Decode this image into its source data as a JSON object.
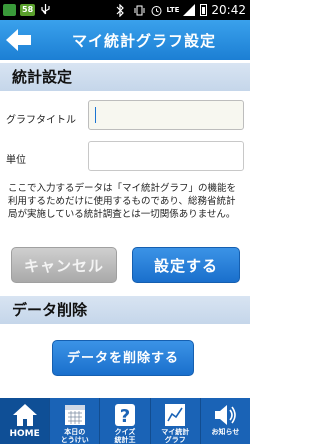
{
  "status_bar": {
    "badge": "58",
    "network": "LTE",
    "time": "20:42"
  },
  "header": {
    "title": "マイ統計グラフ設定"
  },
  "stats_settings": {
    "heading": "統計設定",
    "graph_title_label": "グラフタイトル",
    "graph_title_value": "",
    "unit_label": "単位",
    "unit_value": "",
    "notice": "ここで入力するデータは「マイ統計グラフ」の機能を利用するためだけに使用するものであり、総務省統計局が実施している統計調査とは一切関係ありません。",
    "cancel_label": "キャンセル",
    "set_label": "設定する"
  },
  "data_delete": {
    "heading": "データ削除",
    "delete_label": "データを削除する"
  },
  "tabbar": {
    "items": [
      {
        "label": "HOME",
        "icon": "home-icon"
      },
      {
        "label": "本日の\nとうけい",
        "icon": "calendar-icon"
      },
      {
        "label": "クイズ\n統計王",
        "icon": "question-icon"
      },
      {
        "label": "マイ統計\nグラフ",
        "icon": "chart-icon"
      },
      {
        "label": "お知らせ",
        "icon": "speaker-icon"
      }
    ]
  },
  "colors": {
    "header": "#1c7fd4",
    "section": "#c5d6ea",
    "button_primary": "#1a6fcc",
    "button_disabled": "#a9a9a9",
    "tabbar": "#1a63b6"
  }
}
